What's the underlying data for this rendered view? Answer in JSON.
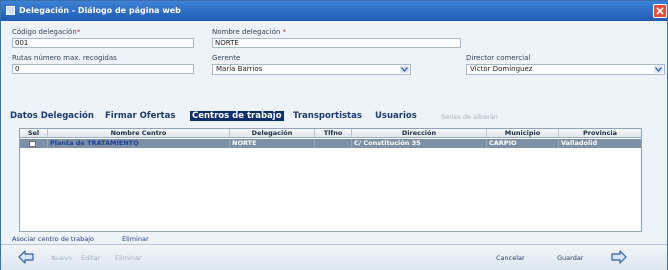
{
  "window": {
    "title": "Delegación - Diálogo de página web"
  },
  "form": {
    "codigo": {
      "label": "Código delegación",
      "value": "001"
    },
    "nombre": {
      "label": "Nombre delegación",
      "value": "NORTE"
    },
    "rutas": {
      "label": "Rutas número max. recogidas",
      "value": "0"
    },
    "gerente": {
      "label": "Gerente",
      "value": "María Barrios"
    },
    "director": {
      "label": "Director comercial",
      "value": "Víctor Domínguez"
    }
  },
  "tabs": [
    {
      "label": "Datos Delegación"
    },
    {
      "label": "Firmar Ofertas"
    },
    {
      "label": "Centros de trabajo"
    },
    {
      "label": "Transportistas"
    },
    {
      "label": "Usuarios"
    },
    {
      "label": "Series de albarán"
    }
  ],
  "grid": {
    "columns": [
      "Sel",
      "Nombre Centro",
      "Delegación",
      "Tlfno",
      "Dirección",
      "Municipio",
      "Provincia"
    ],
    "rows": [
      {
        "nombre_centro": "Planta de TRATAMIENTO",
        "delegacion": "NORTE",
        "tlfno": "",
        "direccion": "C/ Constitución 35",
        "municipio": "CARPIO",
        "provincia": "Valladolid"
      }
    ]
  },
  "actions": {
    "asociar": "Asociar centro de trabajo",
    "eliminar": "Eliminar"
  },
  "footer": {
    "nuevo": "Nuevo",
    "editar": "Editar",
    "eliminar": "Eliminar",
    "cancelar": "Cancelar",
    "guardar": "Guardar"
  }
}
